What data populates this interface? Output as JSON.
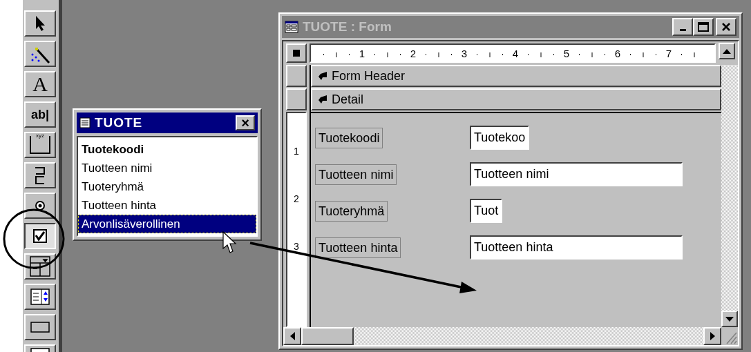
{
  "toolbox": [
    {
      "kind": "pointer",
      "selected": false
    },
    {
      "kind": "wand",
      "selected": false
    },
    {
      "kind": "label",
      "text": "A",
      "selected": false
    },
    {
      "kind": "textbox",
      "text": "ab|",
      "selected": false
    },
    {
      "kind": "group",
      "text": "xyz",
      "selected": false
    },
    {
      "kind": "toggle",
      "selected": false
    },
    {
      "kind": "radio",
      "selected": false
    },
    {
      "kind": "checkbox",
      "selected": true
    },
    {
      "kind": "combo",
      "selected": false
    },
    {
      "kind": "list",
      "selected": false
    },
    {
      "kind": "button",
      "selected": false
    },
    {
      "kind": "partial",
      "selected": false
    }
  ],
  "field_list": {
    "title": "TUOTE",
    "close": "×",
    "items": [
      {
        "label": "Tuotekoodi",
        "key_field": true,
        "selected": false
      },
      {
        "label": "Tuotteen nimi",
        "key_field": false,
        "selected": false
      },
      {
        "label": "Tuoteryhmä",
        "key_field": false,
        "selected": false
      },
      {
        "label": "Tuotteen hinta",
        "key_field": false,
        "selected": false
      },
      {
        "label": "Arvonlisäverollinen",
        "key_field": false,
        "selected": true
      }
    ]
  },
  "form_window": {
    "title": "TUOTE : Form",
    "active": false,
    "ruler": [
      "1",
      "2",
      "3",
      "4",
      "5",
      "6",
      "7"
    ],
    "vertical_ruler": [
      "1",
      "2",
      "3"
    ],
    "sections": [
      {
        "label": "Form Header"
      },
      {
        "label": "Detail"
      }
    ],
    "controls": [
      {
        "label": "Tuotekoodi",
        "value": "Tuotekoo",
        "truncated": true
      },
      {
        "label": "Tuotteen nimi",
        "value": "Tuotteen nimi",
        "truncated": false
      },
      {
        "label": "Tuoteryhmä",
        "value": "Tuot",
        "truncated": true
      },
      {
        "label": "Tuotteen hinta",
        "value": "Tuotteen hinta",
        "truncated": false
      }
    ]
  }
}
